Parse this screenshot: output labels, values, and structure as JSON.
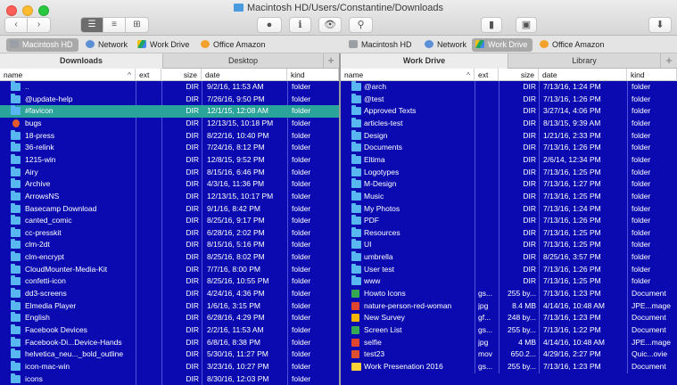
{
  "window": {
    "title": "Macintosh HD/Users/Constantine/Downloads"
  },
  "toolbar": {
    "back_glyph": "‹",
    "forward_glyph": "›",
    "view_modes": [
      "☰",
      "≡",
      "⊞"
    ],
    "toggle_glyph": "●",
    "info_glyph": "ℹ",
    "eye_glyph": "👁",
    "binoculars_glyph": "⚲",
    "pane_glyph": "▮",
    "drive_glyph": "▣",
    "download_glyph": "⬇"
  },
  "devices": {
    "left": [
      {
        "label": "Macintosh HD",
        "icon": "hd",
        "selected": true
      },
      {
        "label": "Network",
        "icon": "net",
        "selected": false
      },
      {
        "label": "Work Drive",
        "icon": "drive",
        "selected": false
      },
      {
        "label": "Office Amazon",
        "icon": "office",
        "selected": false
      }
    ],
    "right": [
      {
        "label": "Macintosh HD",
        "icon": "hd",
        "selected": false
      },
      {
        "label": "Network",
        "icon": "net",
        "selected": false
      },
      {
        "label": "Work Drive",
        "icon": "drive",
        "selected": true
      },
      {
        "label": "Office Amazon",
        "icon": "office",
        "selected": false
      }
    ]
  },
  "tabs": {
    "left": [
      {
        "label": "Downloads",
        "active": true
      },
      {
        "label": "Desktop",
        "active": false
      }
    ],
    "right": [
      {
        "label": "Work Drive",
        "active": true
      },
      {
        "label": "Library",
        "active": false
      }
    ],
    "add_glyph": "+"
  },
  "columns": {
    "name": "name",
    "ext": "ext",
    "size": "size",
    "date": "date",
    "kind": "kind",
    "sort_glyph": "^"
  },
  "left_pane": {
    "rows": [
      {
        "name": "..",
        "ext": "",
        "size": "DIR",
        "date": "9/2/16, 11:53 AM",
        "kind": "folder",
        "icon": "folder"
      },
      {
        "name": "@update-help",
        "ext": "",
        "size": "DIR",
        "date": "7/26/16, 9:50 PM",
        "kind": "folder",
        "icon": "folder"
      },
      {
        "name": "#favicon",
        "ext": "",
        "size": "DIR",
        "date": "12/1/15, 12:08 AM",
        "kind": "folder",
        "icon": "folder",
        "selected": true
      },
      {
        "name": "bugs",
        "ext": "",
        "size": "DIR",
        "date": "12/13/15, 10:18 PM",
        "kind": "folder",
        "icon": "bug"
      },
      {
        "name": "18-press",
        "ext": "",
        "size": "DIR",
        "date": "8/22/16, 10:40 PM",
        "kind": "folder",
        "icon": "folder"
      },
      {
        "name": "36-relink",
        "ext": "",
        "size": "DIR",
        "date": "7/24/16, 8:12 PM",
        "kind": "folder",
        "icon": "folder"
      },
      {
        "name": "1215-win",
        "ext": "",
        "size": "DIR",
        "date": "12/8/15, 9:52 PM",
        "kind": "folder",
        "icon": "folder"
      },
      {
        "name": "Airy",
        "ext": "",
        "size": "DIR",
        "date": "8/15/16, 6:46 PM",
        "kind": "folder",
        "icon": "folder"
      },
      {
        "name": "Archive",
        "ext": "",
        "size": "DIR",
        "date": "4/3/16, 11:36 PM",
        "kind": "folder",
        "icon": "folder"
      },
      {
        "name": "ArrowsNS",
        "ext": "",
        "size": "DIR",
        "date": "12/13/15, 10:17 PM",
        "kind": "folder",
        "icon": "folder"
      },
      {
        "name": "Basecamp Download",
        "ext": "",
        "size": "DIR",
        "date": "9/1/16, 8:42 PM",
        "kind": "folder",
        "icon": "folder"
      },
      {
        "name": "canted_comic",
        "ext": "",
        "size": "DIR",
        "date": "8/25/16, 9:17 PM",
        "kind": "folder",
        "icon": "folder"
      },
      {
        "name": "cc-presskit",
        "ext": "",
        "size": "DIR",
        "date": "6/28/16, 2:02 PM",
        "kind": "folder",
        "icon": "folder"
      },
      {
        "name": "clm-2dt",
        "ext": "",
        "size": "DIR",
        "date": "8/15/16, 5:16 PM",
        "kind": "folder",
        "icon": "folder"
      },
      {
        "name": "clm-encrypt",
        "ext": "",
        "size": "DIR",
        "date": "8/25/16, 8:02 PM",
        "kind": "folder",
        "icon": "folder"
      },
      {
        "name": "CloudMounter-Media-Kit",
        "ext": "",
        "size": "DIR",
        "date": "7/7/16, 8:00 PM",
        "kind": "folder",
        "icon": "folder"
      },
      {
        "name": "confetti-icon",
        "ext": "",
        "size": "DIR",
        "date": "8/25/16, 10:55 PM",
        "kind": "folder",
        "icon": "folder"
      },
      {
        "name": "dd3-screens",
        "ext": "",
        "size": "DIR",
        "date": "4/24/16, 4:36 PM",
        "kind": "folder",
        "icon": "folder"
      },
      {
        "name": "Elmedia Player",
        "ext": "",
        "size": "DIR",
        "date": "1/6/16, 3:15 PM",
        "kind": "folder",
        "icon": "folder"
      },
      {
        "name": "English",
        "ext": "",
        "size": "DIR",
        "date": "6/28/16, 4:29 PM",
        "kind": "folder",
        "icon": "folder"
      },
      {
        "name": "Facebook Devices",
        "ext": "",
        "size": "DIR",
        "date": "2/2/16, 11:53 AM",
        "kind": "folder",
        "icon": "folder"
      },
      {
        "name": "Facebook-Di...Device-Hands",
        "ext": "",
        "size": "DIR",
        "date": "6/8/16, 8:38 PM",
        "kind": "folder",
        "icon": "folder"
      },
      {
        "name": "helvetica_neu..._bold_outline",
        "ext": "",
        "size": "DIR",
        "date": "5/30/16, 11:27 PM",
        "kind": "folder",
        "icon": "folder"
      },
      {
        "name": "icon-mac-win",
        "ext": "",
        "size": "DIR",
        "date": "3/23/16, 10:27 PM",
        "kind": "folder",
        "icon": "folder"
      },
      {
        "name": "icons",
        "ext": "",
        "size": "DIR",
        "date": "8/30/16, 12:03 PM",
        "kind": "folder",
        "icon": "folder"
      }
    ]
  },
  "right_pane": {
    "rows": [
      {
        "name": "@arch",
        "ext": "",
        "size": "DIR",
        "date": "7/13/16, 1:24 PM",
        "kind": "folder",
        "icon": "folder"
      },
      {
        "name": "@test",
        "ext": "",
        "size": "DIR",
        "date": "7/13/16, 1:26 PM",
        "kind": "folder",
        "icon": "folder"
      },
      {
        "name": "Approved Texts",
        "ext": "",
        "size": "DIR",
        "date": "3/27/14, 4:06 PM",
        "kind": "folder",
        "icon": "folder"
      },
      {
        "name": "articles-test",
        "ext": "",
        "size": "DIR",
        "date": "8/13/15, 9:39 AM",
        "kind": "folder",
        "icon": "folder"
      },
      {
        "name": "Design",
        "ext": "",
        "size": "DIR",
        "date": "1/21/16, 2:33 PM",
        "kind": "folder",
        "icon": "folder"
      },
      {
        "name": "Documents",
        "ext": "",
        "size": "DIR",
        "date": "7/13/16, 1:26 PM",
        "kind": "folder",
        "icon": "folder"
      },
      {
        "name": "Eltima",
        "ext": "",
        "size": "DIR",
        "date": "2/6/14, 12:34 PM",
        "kind": "folder",
        "icon": "folder"
      },
      {
        "name": "Logotypes",
        "ext": "",
        "size": "DIR",
        "date": "7/13/16, 1:25 PM",
        "kind": "folder",
        "icon": "folder"
      },
      {
        "name": "M-Design",
        "ext": "",
        "size": "DIR",
        "date": "7/13/16, 1:27 PM",
        "kind": "folder",
        "icon": "folder"
      },
      {
        "name": "Music",
        "ext": "",
        "size": "DIR",
        "date": "7/13/16, 1:25 PM",
        "kind": "folder",
        "icon": "folder"
      },
      {
        "name": "My Photos",
        "ext": "",
        "size": "DIR",
        "date": "7/13/16, 1:24 PM",
        "kind": "folder",
        "icon": "folder"
      },
      {
        "name": "PDF",
        "ext": "",
        "size": "DIR",
        "date": "7/13/16, 1:26 PM",
        "kind": "folder",
        "icon": "folder"
      },
      {
        "name": "Resources",
        "ext": "",
        "size": "DIR",
        "date": "7/13/16, 1:25 PM",
        "kind": "folder",
        "icon": "folder"
      },
      {
        "name": "UI",
        "ext": "",
        "size": "DIR",
        "date": "7/13/16, 1:25 PM",
        "kind": "folder",
        "icon": "folder"
      },
      {
        "name": "umbrella",
        "ext": "",
        "size": "DIR",
        "date": "8/25/16, 3:57 PM",
        "kind": "folder",
        "icon": "folder"
      },
      {
        "name": "User test",
        "ext": "",
        "size": "DIR",
        "date": "7/13/16, 1:26 PM",
        "kind": "folder",
        "icon": "folder"
      },
      {
        "name": "www",
        "ext": "",
        "size": "DIR",
        "date": "7/13/16, 1:25 PM",
        "kind": "folder",
        "icon": "folder"
      },
      {
        "name": "Howto Icons",
        "ext": "gs...",
        "size": "255 by...",
        "date": "7/13/16, 1:23 PM",
        "kind": "Document",
        "icon": "doc-green"
      },
      {
        "name": "nature-person-red-woman",
        "ext": "jpg",
        "size": "8.4 MB",
        "date": "4/14/16, 10:48 AM",
        "kind": "JPE...mage",
        "icon": "doc-red"
      },
      {
        "name": "New Survey",
        "ext": "gf...",
        "size": "248 by...",
        "date": "7/13/16, 1:23 PM",
        "kind": "Document",
        "icon": "doc-slides"
      },
      {
        "name": "Screen List",
        "ext": "gs...",
        "size": "255 by...",
        "date": "7/13/16, 1:22 PM",
        "kind": "Document",
        "icon": "doc-green"
      },
      {
        "name": "selfie",
        "ext": "jpg",
        "size": "4 MB",
        "date": "4/14/16, 10:48 AM",
        "kind": "JPE...mage",
        "icon": "doc-red"
      },
      {
        "name": "test23",
        "ext": "mov",
        "size": "650.2...",
        "date": "4/29/16, 2:27 PM",
        "kind": "Quic...ovie",
        "icon": "doc-video"
      },
      {
        "name": "Work Presenation 2016",
        "ext": "gs...",
        "size": "255 by...",
        "date": "7/13/16, 1:23 PM",
        "kind": "Document",
        "icon": "doc-yellow"
      }
    ]
  }
}
